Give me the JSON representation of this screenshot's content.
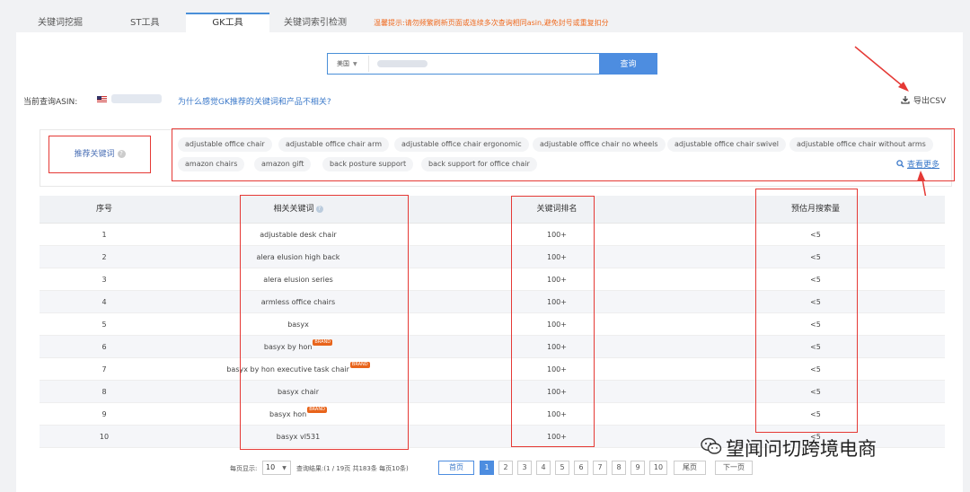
{
  "tabs": [
    {
      "label": "关键词挖掘"
    },
    {
      "label": "ST工具"
    },
    {
      "label": "GK工具",
      "active": true
    },
    {
      "label": "关键词索引检测"
    }
  ],
  "notice": "温馨提示:请勿频繁刷新页面或连续多次查询相同asin,避免封号或重复扣分",
  "search": {
    "select_value": "美国",
    "button_label": "查询"
  },
  "asin_bar": {
    "label": "当前查询ASIN:",
    "why_link": "为什么感觉GK推荐的关键词和产品不相关?",
    "export_label": "导出CSV"
  },
  "recommend": {
    "label": "推荐关键词",
    "tags": [
      "adjustable office chair",
      "adjustable office chair arm",
      "adjustable office chair ergonomic",
      "adjustable office chair no wheels",
      "adjustable office chair swivel",
      "adjustable office chair without arms",
      "amazon chairs",
      "amazon gift",
      "back posture support",
      "back support for office chair"
    ],
    "see_more": "查看更多"
  },
  "table": {
    "headers": [
      "序号",
      "相关关键词",
      "关键词排名",
      "预估月搜索量"
    ],
    "rows": [
      {
        "no": "1",
        "keyword": "adjustable desk chair",
        "brand": "",
        "rank": "100+",
        "volume": "<5"
      },
      {
        "no": "2",
        "keyword": "alera elusion high back",
        "brand": "",
        "rank": "100+",
        "volume": "<5"
      },
      {
        "no": "3",
        "keyword": "alera elusion series",
        "brand": "",
        "rank": "100+",
        "volume": "<5"
      },
      {
        "no": "4",
        "keyword": "armless office chairs",
        "brand": "",
        "rank": "100+",
        "volume": "<5"
      },
      {
        "no": "5",
        "keyword": "basyx",
        "brand": "",
        "rank": "100+",
        "volume": "<5"
      },
      {
        "no": "6",
        "keyword": "basyx by hon",
        "brand": "BRAND",
        "rank": "100+",
        "volume": "<5"
      },
      {
        "no": "7",
        "keyword": "basyx by hon executive task chair",
        "brand": "BRAND",
        "rank": "100+",
        "volume": "<5"
      },
      {
        "no": "8",
        "keyword": "basyx chair",
        "brand": "",
        "rank": "100+",
        "volume": "<5"
      },
      {
        "no": "9",
        "keyword": "basyx hon",
        "brand": "BRAND",
        "rank": "100+",
        "volume": "<5"
      },
      {
        "no": "10",
        "keyword": "basyx vl531",
        "brand": "",
        "rank": "100+",
        "volume": "<5"
      }
    ]
  },
  "pager": {
    "page_size_label": "每页显示:",
    "page_size": "10",
    "query_result": "查询结果:(1 / 19页 共183条 每页10条)",
    "first": "首页",
    "pages": [
      "1",
      "2",
      "3",
      "4",
      "5",
      "6",
      "7",
      "8",
      "9",
      "10"
    ],
    "last": "尾页",
    "next": "下一页"
  },
  "watermark": "望闻问切跨境电商",
  "colors": {
    "accent": "#4d8de0",
    "annotation_red": "#e53935",
    "notice_orange": "#f06a1f"
  }
}
